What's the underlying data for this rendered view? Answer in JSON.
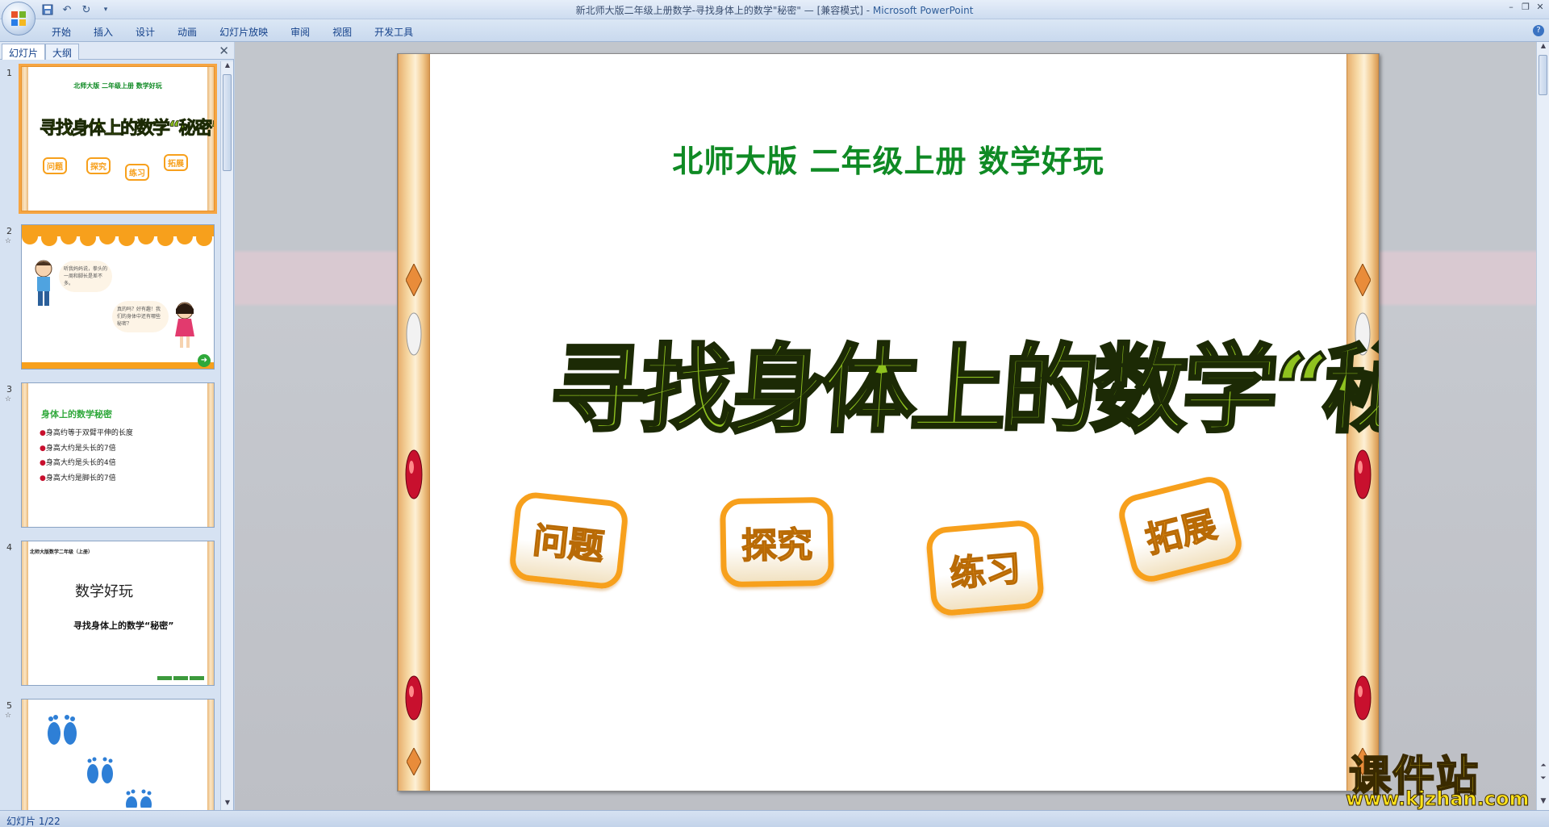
{
  "window": {
    "title": "新北师大版二年级上册数学-寻找身体上的数学\"秘密\" — [兼容模式] - ",
    "app_name": "Microsoft PowerPoint"
  },
  "ribbon": {
    "tabs": [
      "开始",
      "插入",
      "设计",
      "动画",
      "幻灯片放映",
      "审阅",
      "视图",
      "开发工具"
    ]
  },
  "left_panel": {
    "tabs": [
      "幻灯片",
      "大纲"
    ],
    "thumbnails": [
      {
        "number": "1",
        "subtitle": "北师大版 二年级上册 数学好玩",
        "title": "寻找身体上的数学“秘密”",
        "badges": [
          "问题",
          "探究",
          "练习",
          "拓展"
        ]
      },
      {
        "number": "2",
        "bubble1": "听我妈妈说，拳头的一周和脚长是差不多。",
        "bubble2": "真的吗？好有趣！我们的身体中还有哪些秘密？"
      },
      {
        "number": "3",
        "heading": "身体上的数学秘密",
        "bullets": [
          "身高约等于双臂平伸的长度",
          "身高大约是头长的7倍",
          "身高大约是头长的4倍",
          "身高大约是脚长的7倍"
        ]
      },
      {
        "number": "4",
        "header": "北师大版数学二年级（上册）",
        "title": "数学好玩",
        "subtitle": "寻找身体上的数学“秘密”"
      },
      {
        "number": "5"
      }
    ]
  },
  "slide": {
    "subtitle": "北师大版  二年级上册  数学好玩",
    "title": "寻找身体上的数学“秘密”",
    "badges": [
      "问题",
      "探究",
      "练习",
      "拓展"
    ]
  },
  "status": {
    "text": "幻灯片 1/22"
  },
  "watermark": {
    "line1": "课件站",
    "line2": "www.kjzhan.com"
  },
  "colors": {
    "title_green": "#8fc21f",
    "subtitle_green": "#0f8a24",
    "badge_orange": "#f7a01c",
    "pillar_tan": "#f8dcaa"
  }
}
